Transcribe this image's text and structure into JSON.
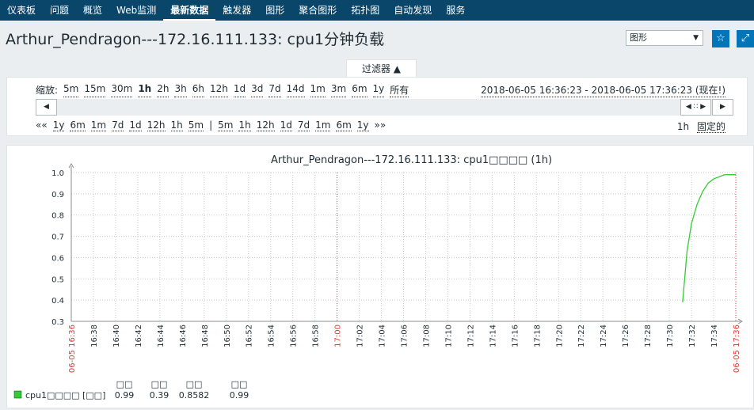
{
  "nav": [
    "仪表板",
    "问题",
    "概览",
    "Web监测",
    "最新数据",
    "触发器",
    "图形",
    "聚合图形",
    "拓扑图",
    "自动发现",
    "服务"
  ],
  "nav_active": 4,
  "page_title": "Arthur_Pendragon---172.16.111.133: cpu1分钟负载",
  "view_select": "图形",
  "filter_tab": "过滤器 ▲",
  "zoom_label": "缩放:",
  "zoom_options": [
    "5m",
    "15m",
    "30m",
    "1h",
    "2h",
    "3h",
    "6h",
    "12h",
    "1d",
    "3d",
    "7d",
    "14d",
    "1m",
    "3m",
    "6m",
    "1y",
    "所有"
  ],
  "zoom_active": "1h",
  "time_range": "2018-06-05 16:36:23 - 2018-06-05 17:36:23 (现在!)",
  "nav_back": [
    "««",
    "1y",
    "6m",
    "1m",
    "7d",
    "1d",
    "12h",
    "1h",
    "5m"
  ],
  "nav_sep": "|",
  "nav_fwd": [
    "5m",
    "1h",
    "12h",
    "1d",
    "7d",
    "1m",
    "6m",
    "1y",
    "»»"
  ],
  "period": "1h",
  "fixed_label": "固定的",
  "icons": {
    "favorite": "star-icon",
    "fullscreen": "expand-icon",
    "left": "triangle-left-icon",
    "right": "triangle-right-icon",
    "handle": "slider-handle-icon"
  },
  "colors": {
    "nav_bg": "#0a466a",
    "series": "#33cc33",
    "red_label": "#e33734",
    "button": "#0275b8"
  },
  "chart_data": {
    "type": "line",
    "title": "Arthur_Pendragon---172.16.111.133: cpu1□□□□ (1h)",
    "ylim": [
      0.3,
      1.0
    ],
    "y_ticks": [
      "1.0",
      "0.9",
      "0.8",
      "0.7",
      "0.6",
      "0.5",
      "0.4",
      "0.3"
    ],
    "x_ticks": [
      "06-05 16:36",
      "16:38",
      "16:40",
      "16:42",
      "16:44",
      "16:46",
      "16:48",
      "16:50",
      "16:52",
      "16:54",
      "16:56",
      "16:58",
      "17:00",
      "17:02",
      "17:04",
      "17:06",
      "17:08",
      "17:10",
      "17:12",
      "17:14",
      "17:16",
      "17:18",
      "17:20",
      "17:22",
      "17:24",
      "17:26",
      "17:28",
      "17:30",
      "17:32",
      "17:34",
      "06-05 17:36"
    ],
    "x_ticks_red": [
      "06-05 16:36",
      "17:00",
      "06-05 17:36"
    ],
    "series": [
      {
        "name": "cpu1□□□□",
        "color": "#33cc33",
        "x_minutes": [
          55.2,
          55.6,
          56.0,
          56.5,
          57.0,
          57.5,
          58.0,
          58.5,
          59.0,
          59.5,
          60.0
        ],
        "values": [
          0.39,
          0.63,
          0.76,
          0.85,
          0.91,
          0.95,
          0.97,
          0.98,
          0.99,
          0.99,
          0.99
        ]
      }
    ],
    "legend": {
      "headers": [
        "□□",
        "□□",
        "□□",
        "□□"
      ],
      "name": "cpu1□□□□",
      "unit": "[□□]",
      "values": [
        "0.99",
        "0.39",
        "0.8582",
        "0.99"
      ]
    }
  }
}
